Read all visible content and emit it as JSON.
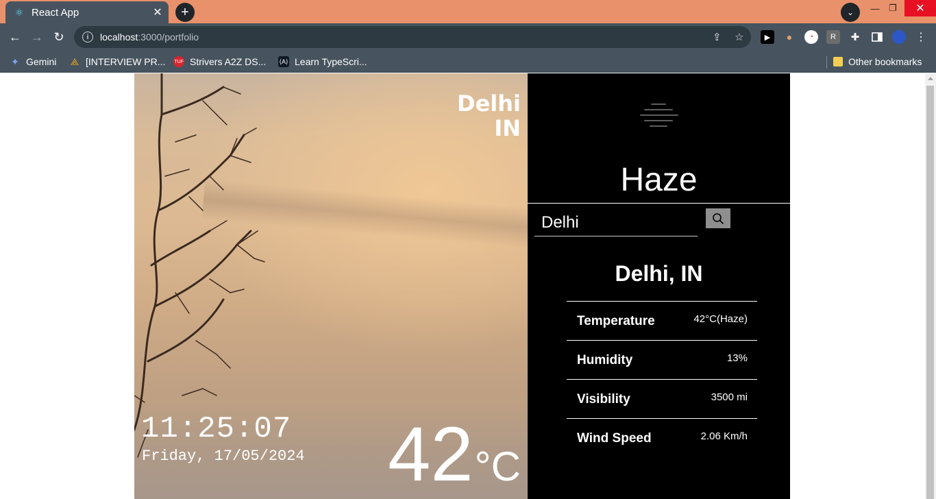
{
  "browser": {
    "tab_title": "React App",
    "url_host": "localhost",
    "url_path": ":3000/portfolio",
    "bookmarks": [
      {
        "label": "Gemini",
        "icon": "gemini-icon"
      },
      {
        "label": "[INTERVIEW PR...",
        "icon": "interview-icon"
      },
      {
        "label": "Strivers A2Z DS...",
        "icon": "tuf-icon"
      },
      {
        "label": "Learn TypeScri...",
        "icon": "typescript-icon"
      }
    ],
    "other_bookmarks": "Other bookmarks",
    "extension_r": "R"
  },
  "hero": {
    "city": "Delhi",
    "country": "IN",
    "time": "11:25:07",
    "date": "Friday, 17/05/2024",
    "temp": "42",
    "temp_unit": "°C"
  },
  "panel": {
    "icon": "haze-icon",
    "condition": "Haze",
    "search_value": "Delhi",
    "location": "Delhi, IN",
    "details": [
      {
        "label": "Temperature",
        "value": "42°C(Haze)"
      },
      {
        "label": "Humidity",
        "value": "13%"
      },
      {
        "label": "Visibility",
        "value": "3500 mi"
      },
      {
        "label": "Wind Speed",
        "value": "2.06 Km/h"
      }
    ]
  },
  "colors": {
    "titlebar": "#e9916a",
    "toolbar": "#47545f",
    "panel_bg": "#000000",
    "search_button": "#8e8e8e"
  }
}
